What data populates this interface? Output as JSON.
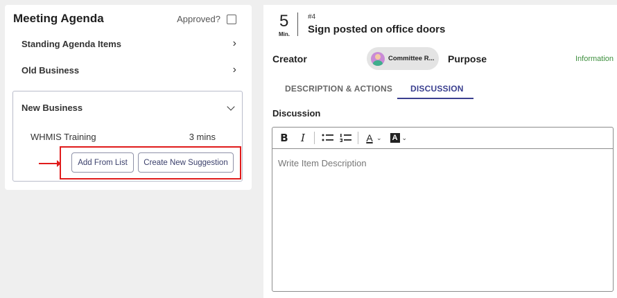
{
  "left": {
    "title": "Meeting Agenda",
    "approved_label": "Approved?",
    "sections": {
      "standing": "Standing Agenda Items",
      "old": "Old Business",
      "new": "New Business"
    },
    "new_business_item": {
      "name": "WHMIS Training",
      "duration": "3 mins"
    },
    "buttons": {
      "add_from_list": "Add From List",
      "create_new": "Create New Suggestion"
    },
    "chevron_right": "›"
  },
  "right": {
    "minutes": "5",
    "minutes_label": "Min.",
    "item_number": "#4",
    "item_title": "Sign posted on office doors",
    "creator_label": "Creator",
    "creator_chip": "Committee R...",
    "purpose_label": "Purpose",
    "purpose_value": "Information",
    "tabs": [
      "DESCRIPTION & ACTIONS",
      "DISCUSSION"
    ],
    "active_tab": "DISCUSSION",
    "discussion_label": "Discussion",
    "editor": {
      "placeholder": "Write Item Description",
      "toolbar": {
        "bold": "B",
        "italic": "I",
        "font_color": "A",
        "bg_color": "A",
        "caret": "⌄"
      }
    }
  },
  "colors": {
    "accent": "#3a3f8f",
    "highlight": "#e01b1b",
    "purpose": "#3d8f3d"
  }
}
